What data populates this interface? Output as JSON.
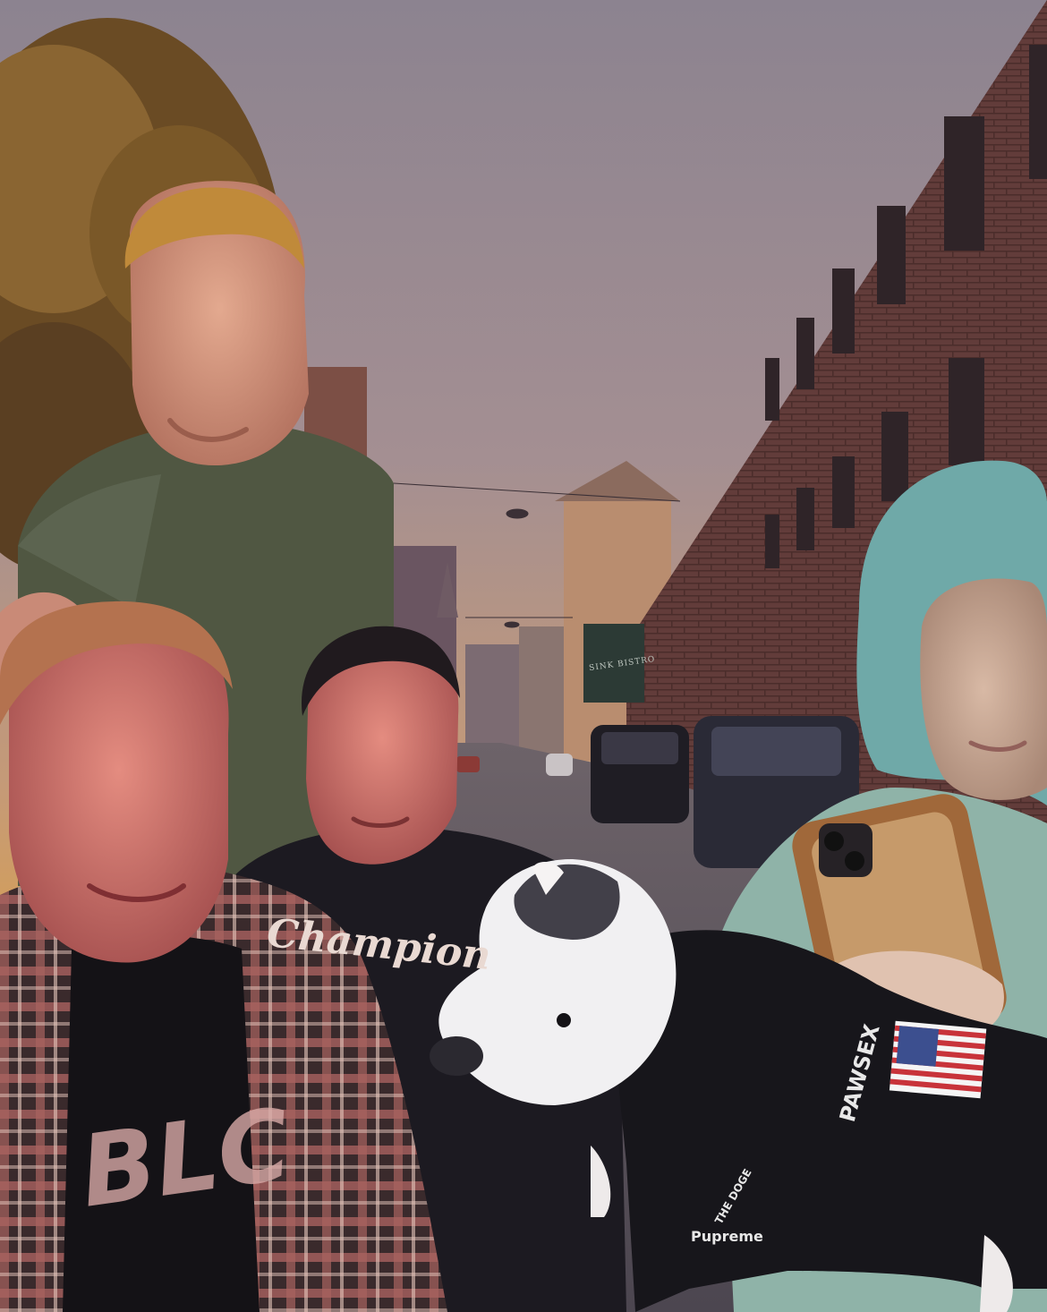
{
  "scene": {
    "colors": {
      "sky_top": "#8c8390",
      "sky_mid": "#b39a8e",
      "sunset": "#d9a04f",
      "brick": "#6e4440",
      "street": "#5d5560",
      "tree": "#7a5a2a"
    }
  },
  "visible_text": {
    "tshirt_brand": "Champion",
    "tshirt_graphic": "BLC",
    "jacket_print": "PAWSEX",
    "jacket_logo": "THE DOGE",
    "jacket_collab": "Pupreme",
    "shop_sign": "SINK BISTRO"
  },
  "icons": [
    "us-flag-patch-icon",
    "phone-camera-icon"
  ]
}
